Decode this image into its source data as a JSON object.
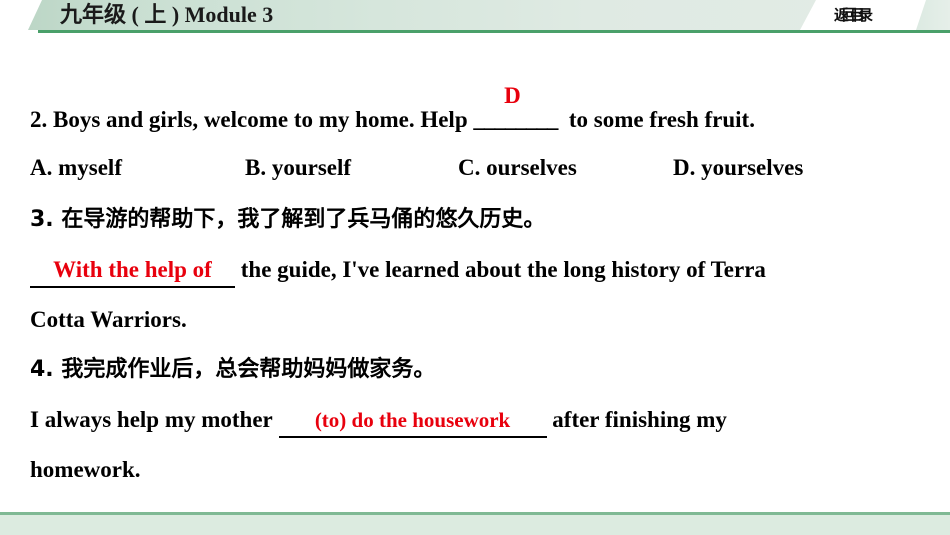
{
  "header": {
    "title_cn": "九年级（上）",
    "title_full": "九年级 ( 上 ) Module 3",
    "back_button": "返回目录",
    "accent_color": "#4aa06a",
    "bg_color": "#c9dfd2"
  },
  "answer_color": "#e8000d",
  "questions": [
    {
      "number": "2.",
      "stem_before": "2. Boys and girls, welcome to my home. Help",
      "blank": "________",
      "answer_letter": "D",
      "stem_after": "to some fresh fruit.",
      "options": [
        {
          "key": "A.",
          "text": "A. myself"
        },
        {
          "key": "B.",
          "text": "B. yourself"
        },
        {
          "key": "C.",
          "text": "C. ourselves"
        },
        {
          "key": "D.",
          "text": "D. yourselves"
        }
      ]
    },
    {
      "number": "3.",
      "prompt_cn": "3. 在导游的帮助下，我了解到了兵马俑的悠久历史。",
      "answer": "With the help of",
      "rest_line1": "the guide, I've learned about the long history of Terra",
      "rest_line2": "Cotta Warriors."
    },
    {
      "number": "4.",
      "prompt_cn": "4. 我完成作业后，总会帮助妈妈做家务。",
      "lead": "I always help my mother",
      "answer": "(to) do the housework",
      "rest_line1": "after finishing my",
      "rest_line2": "homework."
    }
  ]
}
